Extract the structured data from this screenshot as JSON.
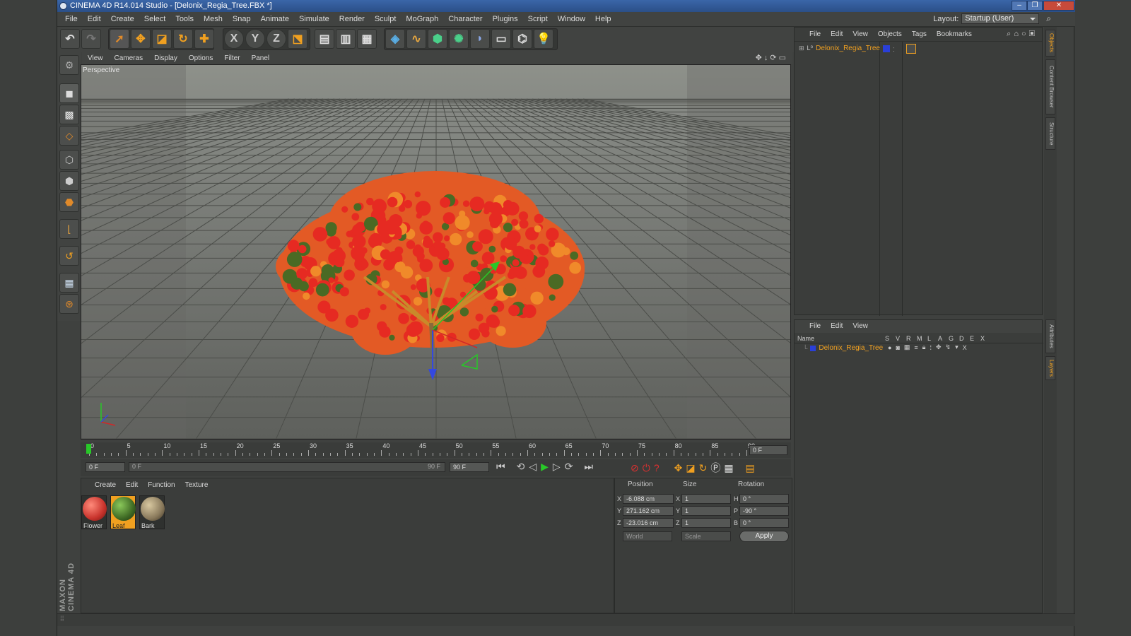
{
  "window": {
    "title": "CINEMA 4D R14.014 Studio - [Delonix_Regia_Tree.FBX *]",
    "controls": [
      "minimize-icon",
      "restore-icon",
      "close-icon"
    ]
  },
  "menu": [
    "File",
    "Edit",
    "Create",
    "Select",
    "Tools",
    "Mesh",
    "Snap",
    "Animate",
    "Simulate",
    "Render",
    "Sculpt",
    "MoGraph",
    "Character",
    "Plugins",
    "Script",
    "Window",
    "Help"
  ],
  "layout": {
    "label": "Layout:",
    "value": "Startup (User)"
  },
  "axis_buttons": [
    "X",
    "Y",
    "Z"
  ],
  "viewport": {
    "menu": [
      "View",
      "Cameras",
      "Display",
      "Options",
      "Filter",
      "Panel"
    ],
    "label": "Perspective"
  },
  "timeline": {
    "ticks": [
      "0",
      "5",
      "10",
      "15",
      "20",
      "25",
      "30",
      "35",
      "40",
      "45",
      "50",
      "55",
      "60",
      "65",
      "70",
      "75",
      "80",
      "85",
      "90"
    ],
    "current": "0 F",
    "start": "0 F",
    "range_start": "0 F",
    "range_end": "90 F",
    "end": "90 F"
  },
  "materials": {
    "menu": [
      "Create",
      "Edit",
      "Function",
      "Texture"
    ],
    "items": [
      {
        "name": "Flower",
        "color": "#c8332c",
        "selected": false
      },
      {
        "name": "Leaf",
        "color": "#3f6a24",
        "selected": true
      },
      {
        "name": "Bark",
        "color": "#8a7a5c",
        "selected": false
      }
    ]
  },
  "coordinates": {
    "headers": [
      "Position",
      "Size",
      "Rotation"
    ],
    "rows": [
      {
        "axis": "X",
        "pos": "-6.088 cm",
        "size_axis": "X",
        "size": "1",
        "rot_axis": "H",
        "rot": "0 °"
      },
      {
        "axis": "Y",
        "pos": "271.162 cm",
        "size_axis": "Y",
        "size": "1",
        "rot_axis": "P",
        "rot": "-90 °"
      },
      {
        "axis": "Z",
        "pos": "-23.016 cm",
        "size_axis": "Z",
        "size": "1",
        "rot_axis": "B",
        "rot": "0 °"
      }
    ],
    "mode1": "World",
    "mode2": "Scale",
    "apply": "Apply"
  },
  "objects": {
    "menu": [
      "File",
      "Edit",
      "View",
      "Objects",
      "Tags",
      "Bookmarks"
    ],
    "item": "Delonix_Regia_Tree"
  },
  "layers": {
    "menu": [
      "File",
      "Edit",
      "View"
    ],
    "columns": [
      "Name",
      "S",
      "V",
      "R",
      "M",
      "L",
      "A",
      "G",
      "D",
      "E",
      "X"
    ],
    "item": "Delonix_Regia_Tree"
  },
  "side_tabs": [
    "Objects",
    "Content Browser",
    "Structure",
    "Attributes",
    "Layers"
  ],
  "logo": "MAXON CINEMA 4D",
  "colors": {
    "accent": "#f0a020",
    "blue_layer": "#2a3fd8",
    "green_marker": "#28c828"
  }
}
